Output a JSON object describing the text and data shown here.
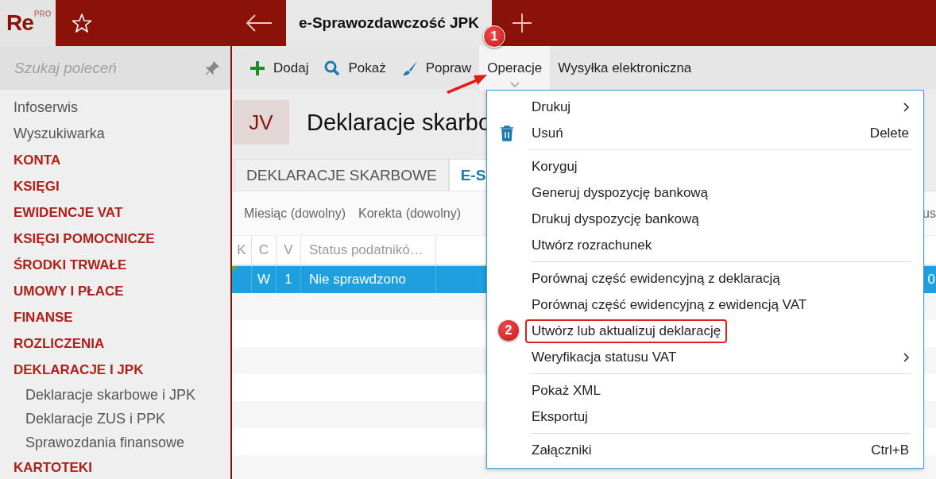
{
  "app": {
    "logo": "Re",
    "logo_badge": "PRO"
  },
  "top_tabs": [
    {
      "label": "e-Sprawozdawczość JPK",
      "selected": true
    }
  ],
  "search": {
    "placeholder": "Szukaj poleceń"
  },
  "sidebar": {
    "items": [
      {
        "label": "Infoserwis",
        "kind": "link"
      },
      {
        "label": "Wyszukiwarka",
        "kind": "link"
      },
      {
        "label": "KONTA",
        "kind": "section"
      },
      {
        "label": "KSIĘGI",
        "kind": "section"
      },
      {
        "label": "EWIDENCJE VAT",
        "kind": "section"
      },
      {
        "label": "KSIĘGI POMOCNICZE",
        "kind": "section"
      },
      {
        "label": "ŚRODKI TRWAŁE",
        "kind": "section"
      },
      {
        "label": "UMOWY I PŁACE",
        "kind": "section"
      },
      {
        "label": "FINANSE",
        "kind": "section"
      },
      {
        "label": "ROZLICZENIA",
        "kind": "section"
      },
      {
        "label": "DEKLARACJE I JPK",
        "kind": "section",
        "children": [
          {
            "label": "Deklaracje skarbowe i JPK"
          },
          {
            "label": "Deklaracje ZUS i PPK"
          },
          {
            "label": "Sprawozdania finansowe"
          }
        ]
      },
      {
        "label": "KARTOTEKI",
        "kind": "section"
      }
    ]
  },
  "toolbar": [
    {
      "label": "Dodaj",
      "kind": "add",
      "selected": false
    },
    {
      "label": "Pokaż",
      "kind": "search",
      "selected": false
    },
    {
      "label": "Popraw",
      "kind": "edit",
      "selected": false
    },
    {
      "label": "Operacje",
      "kind": "dropdown",
      "selected": true,
      "badge": "1"
    },
    {
      "label": "Wysyłka elektroniczna",
      "kind": "plain",
      "selected": false
    }
  ],
  "document": {
    "badge": "JV",
    "title": "Deklaracje skarbo"
  },
  "tabs": [
    {
      "label": "DEKLARACJE SKARBOWE",
      "selected": false
    },
    {
      "label": "E-S",
      "selected": true
    }
  ],
  "filters": {
    "items": [
      "Miesiąc (dowolny)",
      "Korekta (dowolny)"
    ],
    "trailing": "us"
  },
  "table": {
    "columns": [
      "K",
      "C",
      "V",
      "Status podatnikó…"
    ],
    "rows": [
      {
        "c": "W",
        "v": "1",
        "status": "Nie sprawdzono",
        "column_6": "0",
        "selected": true,
        "marked": true
      }
    ]
  },
  "menu": {
    "groups": [
      [
        {
          "label": "Drukuj",
          "kind": "plain",
          "submenu": true,
          "highlighted": false
        },
        {
          "label": "Usuń",
          "kind": "delete",
          "shortcut": "Delete",
          "submenu": false,
          "highlighted": false
        }
      ],
      [
        {
          "label": "Koryguj",
          "kind": "plain",
          "submenu": false,
          "highlighted": false
        },
        {
          "label": "Generuj dyspozycję bankową",
          "kind": "plain",
          "submenu": false,
          "highlighted": false
        },
        {
          "label": "Drukuj dyspozycję bankową",
          "kind": "plain",
          "submenu": false,
          "highlighted": false
        },
        {
          "label": "Utwórz rozrachunek",
          "kind": "plain",
          "submenu": false,
          "highlighted": false
        }
      ],
      [
        {
          "label": "Porównaj część ewidencyjną z deklaracją",
          "kind": "plain",
          "submenu": false,
          "highlighted": false
        },
        {
          "label": "Porównaj część ewidencyjną z ewidencją VAT",
          "kind": "plain",
          "submenu": false,
          "highlighted": false
        },
        {
          "label": "Utwórz lub aktualizuj deklarację",
          "kind": "plain",
          "submenu": false,
          "highlighted": true,
          "badge": "2"
        },
        {
          "label": "Weryfikacja statusu VAT",
          "kind": "plain",
          "submenu": true,
          "highlighted": false
        }
      ],
      [
        {
          "label": "Pokaż XML",
          "kind": "plain",
          "submenu": false,
          "highlighted": false
        },
        {
          "label": "Eksportuj",
          "kind": "plain",
          "submenu": false,
          "highlighted": false
        }
      ],
      [
        {
          "label": "Załączniki",
          "kind": "plain",
          "shortcut": "Ctrl+B",
          "submenu": false,
          "highlighted": false
        }
      ]
    ]
  }
}
